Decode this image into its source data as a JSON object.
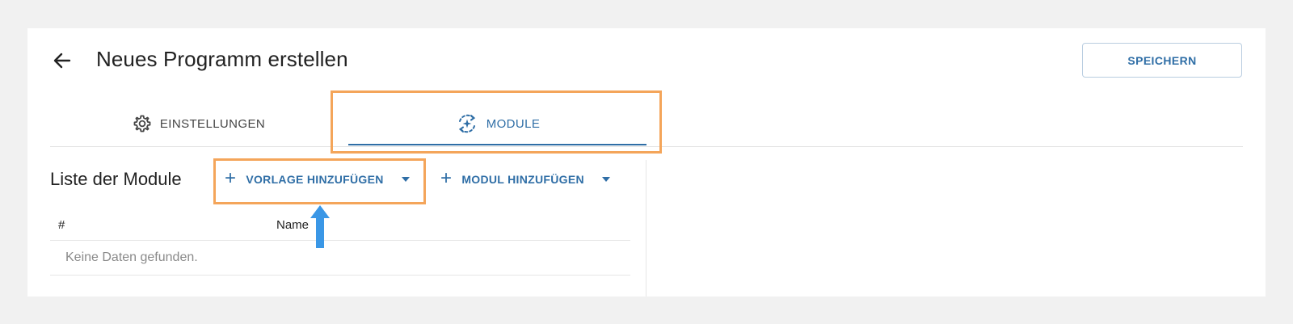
{
  "header": {
    "back_icon": "arrow-left-icon",
    "title": "Neues Programm erstellen",
    "save_label": "SPEICHERN"
  },
  "tabs": [
    {
      "label": "EINSTELLUNGEN",
      "icon": "gear-icon",
      "active": false
    },
    {
      "label": "MODULE",
      "icon": "modules-sync-icon",
      "active": true
    }
  ],
  "modules": {
    "title": "Liste der Module",
    "add_template_label": "VORLAGE HINZUFÜGEN",
    "add_module_label": "MODUL HINZUFÜGEN",
    "columns": [
      "#",
      "Name"
    ],
    "empty_message": "Keine Daten gefunden."
  },
  "colors": {
    "accent": "#2f6ea6",
    "highlight": "#f4a55a",
    "annotation_arrow": "#3a97e6",
    "background": "#f1f1f1"
  }
}
